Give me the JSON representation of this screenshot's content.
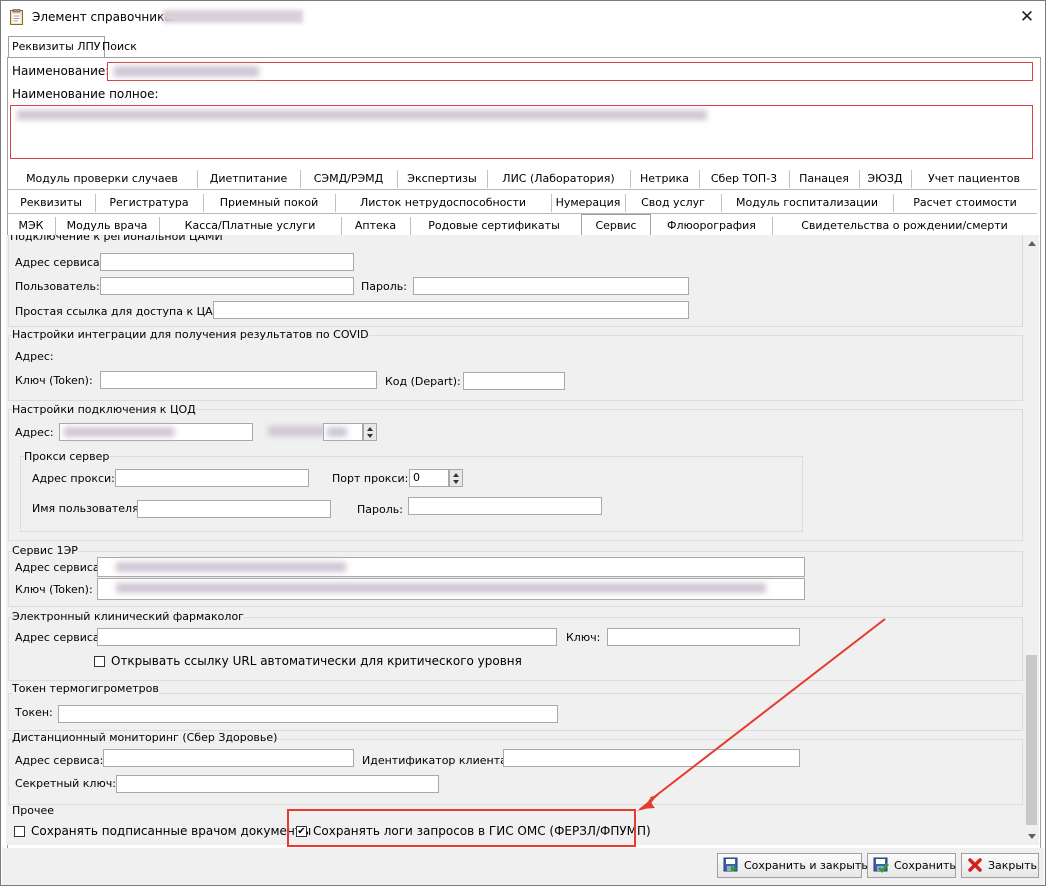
{
  "window": {
    "title": "Элемент справочника:",
    "close_glyph": "✕"
  },
  "outer_tabs": [
    "Реквизиты ЛПУ",
    "Поиск"
  ],
  "header": {
    "name_label": "Наименование:",
    "fullname_label": "Наименование полное:"
  },
  "tab_rows": [
    [
      "Модуль проверки случаев",
      "Диетпитание",
      "СЭМД/РЭМД",
      "Экспертизы",
      "ЛИС (Лаборатория)",
      "Нетрика",
      "Сбер ТОП-3",
      "Панацея",
      "ЭЮЗД",
      "Учет пациентов"
    ],
    [
      "Реквизиты",
      "Регистратура",
      "Приемный покой",
      "Листок нетрудоспособности",
      "Нумерация",
      "Свод услуг",
      "Модуль госпитализации",
      "Расчет стоимости"
    ],
    [
      "МЭК",
      "Модуль врача",
      "Касса/Платные услуги",
      "Аптека",
      "Родовые сертификаты",
      "Сервис",
      "Флюорография",
      "Свидетельства о рождении/смерти"
    ]
  ],
  "active_tab": "Сервис",
  "cami": {
    "title": "Подключение к региональной ЦАМИ",
    "service_address_label": "Адрес сервиса:",
    "user_label": "Пользователь:",
    "password_label": "Пароль:",
    "simple_link_label": "Простая ссылка для доступа к ЦАМИ:"
  },
  "covid": {
    "title": "Настройки интеграции для получения результатов по COVID",
    "address_label": "Адрес:",
    "token_label": "Ключ (Token):",
    "depart_label": "Код (Depart):"
  },
  "cod": {
    "title": "Настройки подключения к ЦОД",
    "address_label": "Адрес:",
    "proxy": {
      "title": "Прокси сервер",
      "address_label": "Адрес прокси:",
      "port_label": "Порт прокси:",
      "port_value": "0",
      "username_label": "Имя пользователя:",
      "password_label": "Пароль:"
    }
  },
  "service1er": {
    "title": "Сервис 1ЭР",
    "address_label": "Адрес сервиса:",
    "token_label": "Ключ (Token):"
  },
  "pharmacologist": {
    "title": "Электронный клинический фармаколог",
    "address_label": "Адрес сервиса:",
    "key_label": "Ключ:",
    "auto_open_label": "Открывать ссылку URL автоматически для критического уровня",
    "auto_open_checked": false
  },
  "thermo": {
    "title": "Токен термогигрометров",
    "token_label": "Токен:"
  },
  "remote": {
    "title": "Дистанционный мониторинг (Сбер Здоровье)",
    "address_label": "Адрес сервиса:",
    "client_id_label": "Идентификатор клиента:",
    "secret_label": "Секретный ключ:"
  },
  "other": {
    "title": "Прочее",
    "save_signed_label": "Сохранять подписанные врачом документы",
    "save_signed_checked": false,
    "save_logs_label": "Сохранять логи запросов в ГИС ОМС (ФЕРЗЛ/ФПУМП)",
    "save_logs_checked": true
  },
  "buttons": {
    "save_close": "Сохранить и закрыть",
    "save": "Сохранить",
    "close": "Закрыть"
  },
  "colors": {
    "highlight": "#e53b30",
    "required_border": "#d94040"
  }
}
